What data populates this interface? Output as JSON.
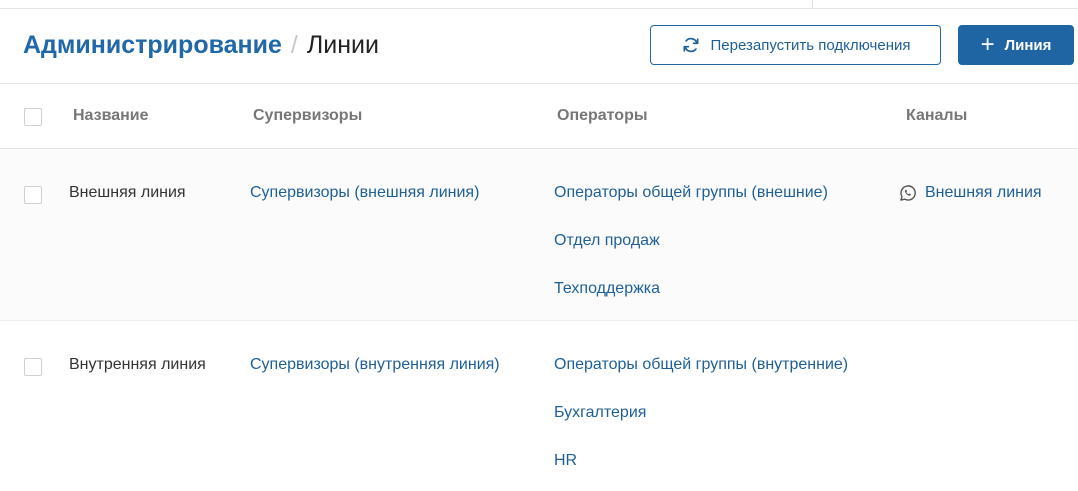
{
  "header": {
    "breadcrumb_parent": "Администрирование",
    "breadcrumb_separator": "/",
    "breadcrumb_current": "Линии",
    "restart_button_label": "Перезапустить подключения",
    "add_button_label": "Линия",
    "add_button_icon": "+"
  },
  "table": {
    "columns": {
      "name": "Название",
      "supervisors": "Супервизоры",
      "operators": "Операторы",
      "channels": "Каналы"
    },
    "rows": [
      {
        "name": "Внешняя линия",
        "supervisors": "Супервизоры (внешняя линия)",
        "operators": [
          "Операторы общей группы (внешние)",
          "Отдел продаж",
          "Техподдержка"
        ],
        "channel": "Внешняя линия",
        "channel_icon": "whatsapp-icon"
      },
      {
        "name": "Внутренняя линия",
        "supervisors": "Супервизоры (внутренняя линия)",
        "operators": [
          "Операторы общей группы (внутренние)",
          "Бухгалтерия",
          "HR"
        ],
        "channel": "",
        "channel_icon": ""
      }
    ]
  },
  "colors": {
    "accent": "#1f65a4",
    "link": "#1f5f97",
    "header_text": "#777777"
  }
}
